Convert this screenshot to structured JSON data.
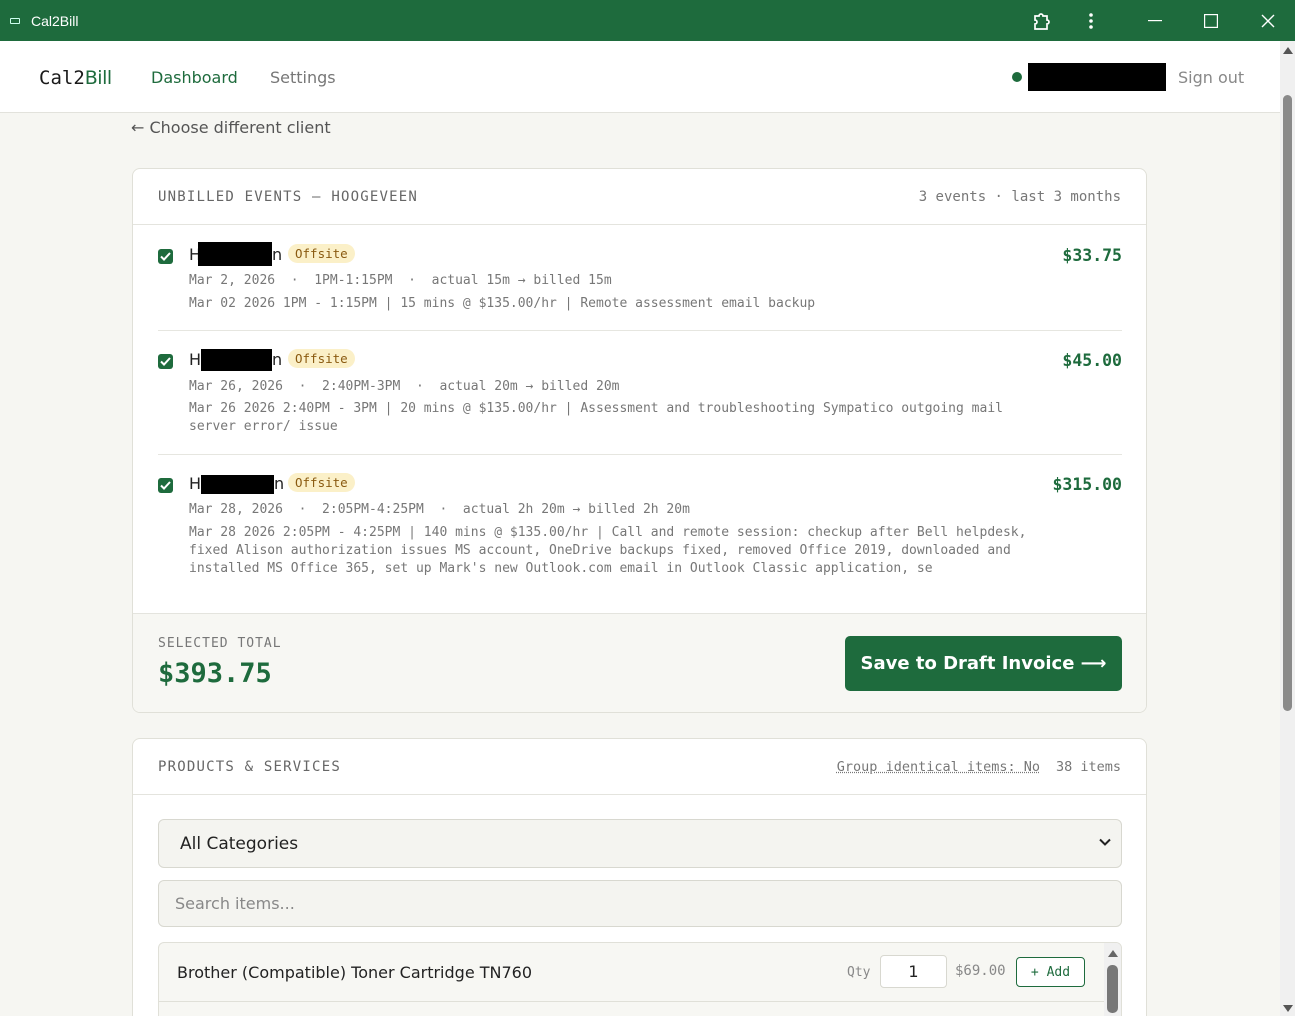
{
  "window": {
    "title": "Cal2Bill"
  },
  "nav": {
    "brand_a": "Cal2",
    "brand_b": "Bill",
    "dashboard": "Dashboard",
    "settings": "Settings",
    "sign_out": "Sign out"
  },
  "back_link": "← Choose different client",
  "events_card": {
    "title": "UNBILLED EVENTS — HOOGEVEEN",
    "summary": "3 events · last 3 months",
    "events": [
      {
        "name_start": "H",
        "name_end": "n",
        "badge": "Offsite",
        "meta": "Mar 2, 2026  ·  1PM-1:15PM  ·  actual 15m → billed 15m",
        "desc": "Mar 02 2026 1PM - 1:15PM | 15 mins @ $135.00/hr | Remote assessment email backup",
        "amount": "$33.75",
        "checked": true
      },
      {
        "name_start": "H",
        "name_end": "n",
        "badge": "Offsite",
        "meta": "Mar 26, 2026  ·  2:40PM-3PM  ·  actual 20m → billed 20m",
        "desc": "Mar 26 2026 2:40PM - 3PM | 20 mins @ $135.00/hr | Assessment and troubleshooting Sympatico outgoing mail server error/ issue",
        "amount": "$45.00",
        "checked": true
      },
      {
        "name_start": "H",
        "name_end": "n",
        "badge": "Offsite",
        "meta": "Mar 28, 2026  ·  2:05PM-4:25PM  ·  actual 2h 20m → billed 2h 20m",
        "desc": "Mar 28 2026 2:05PM - 4:25PM | 140 mins @ $135.00/hr | Call and remote session: checkup after Bell helpdesk, fixed Alison authorization issues MS account, OneDrive backups fixed, removed Office 2019, downloaded and installed MS Office 365, set up Mark's new Outlook.com email in Outlook Classic application, se",
        "amount": "$315.00",
        "checked": true
      }
    ],
    "selected_total_label": "SELECTED TOTAL",
    "selected_total": "$393.75",
    "save_button": "Save to Draft Invoice ⟶"
  },
  "products_card": {
    "title": "PRODUCTS & SERVICES",
    "group_toggle": "Group identical items: No",
    "items_count": "38 items",
    "category_select": "All Categories",
    "search_placeholder": "Search items...",
    "items": [
      {
        "name": "Brother (Compatible) Toner Cartridge TN760",
        "qty_label": "Qty",
        "qty": "1",
        "price": "$69.00",
        "add_label": "+ Add"
      }
    ]
  },
  "colors": {
    "brand_green": "#1e6b3d",
    "badge_bg": "#fbf0c8",
    "badge_fg": "#8a5a10"
  },
  "icons": [
    "app-icon",
    "extension-icon",
    "more-vert-icon",
    "minimize-icon",
    "maximize-icon",
    "close-icon",
    "status-dot-icon",
    "checkbox-icon",
    "chevron-down-icon"
  ]
}
